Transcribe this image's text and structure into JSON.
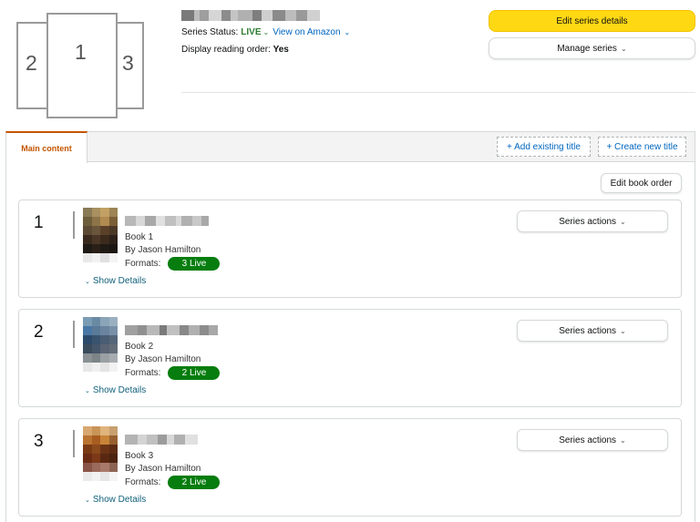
{
  "header": {
    "series_status_label": "Series Status:",
    "series_status_value": "LIVE",
    "view_link": "View on Amazon",
    "reading_order_label": "Display reading order:",
    "reading_order_value": "Yes",
    "cover_numbers": [
      "2",
      "1",
      "3"
    ],
    "edit_series_button": "Edit series details",
    "manage_series_button": "Manage series",
    "accent_color": "#ffd814",
    "live_color": "#2e7d32"
  },
  "tabs": {
    "main_tab": "Main content",
    "add_existing": "+ Add existing title",
    "create_new": "+ Create new title"
  },
  "toolbar": {
    "edit_book_order": "Edit book order"
  },
  "books": [
    {
      "position": "1",
      "book_label": "Book 1",
      "author": "By Jason Hamilton",
      "formats_label": "Formats:",
      "formats_badge": "3 Live",
      "show_details": "Show Details",
      "series_actions": "Series actions"
    },
    {
      "position": "2",
      "book_label": "Book 2",
      "author": "By Jason Hamilton",
      "formats_label": "Formats:",
      "formats_badge": "2 Live",
      "show_details": "Show Details",
      "series_actions": "Series actions"
    },
    {
      "position": "3",
      "book_label": "Book 3",
      "author": "By Jason Hamilton",
      "formats_label": "Formats:",
      "formats_badge": "2 Live",
      "show_details": "Show Details",
      "series_actions": "Series actions"
    }
  ],
  "badge_color": "#067d0e",
  "icons": {
    "chevron": "chevron-down-icon",
    "cover": "series-cover-icon"
  }
}
